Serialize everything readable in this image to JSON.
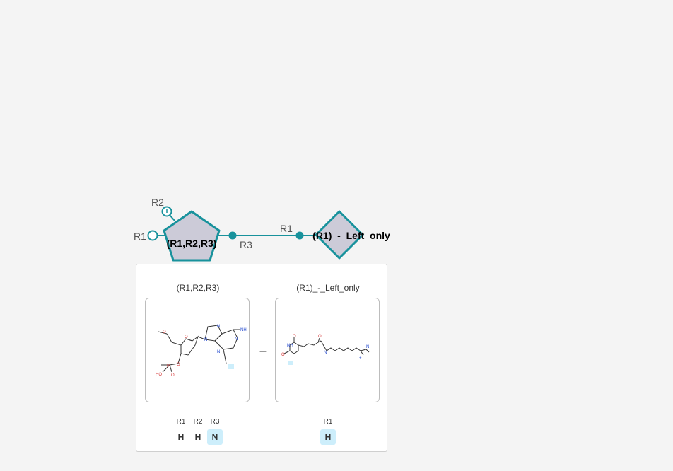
{
  "graph": {
    "monomers": [
      {
        "id": "m1",
        "label": "(R1,R2,R3)",
        "shape": "pentagon",
        "fill": "#cccbd8",
        "stroke": "#18929c"
      },
      {
        "id": "m2",
        "label": "(R1)_-_Left_only",
        "shape": "diamond",
        "fill": "#cccbd8",
        "stroke": "#18929c"
      }
    ],
    "attachment_labels": {
      "m1_r1": "R1",
      "m1_r2": "R2",
      "m1_r3": "R3",
      "m2_r1": "R1"
    },
    "connection": {
      "from": "m1.R3",
      "to": "m2.R1"
    },
    "bond_color": "#18929c"
  },
  "panel": {
    "cards": [
      {
        "title": "(R1,R2,R3)",
        "rgroups": [
          {
            "name": "R1",
            "atom": "H",
            "highlighted": false
          },
          {
            "name": "R2",
            "atom": "H",
            "highlighted": false
          },
          {
            "name": "R3",
            "atom": "N",
            "highlighted": true
          }
        ]
      },
      {
        "title": "(R1)_-_Left_only",
        "rgroups": [
          {
            "name": "R1",
            "atom": "H",
            "highlighted": true
          }
        ]
      }
    ],
    "separator": "–",
    "highlight_color": "#cdeefb"
  }
}
